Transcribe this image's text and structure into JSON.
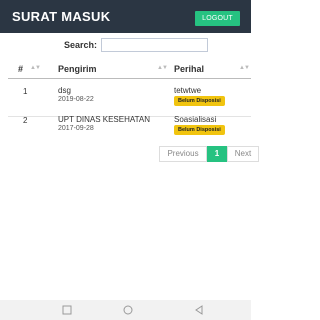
{
  "header": {
    "title": "SURAT MASUK",
    "logout_label": "LOGOUT"
  },
  "search": {
    "label": "Search:",
    "value": "",
    "placeholder": ""
  },
  "table": {
    "columns": [
      "#",
      "Pengirim",
      "Perihal"
    ],
    "rows": [
      {
        "no": "1",
        "sender": "dsg",
        "date": "2019-08-22",
        "subject": "tetwtwe",
        "status": "Belum Disposisi"
      },
      {
        "no": "2",
        "sender": "UPT DINAS KESEHATAN",
        "date": "2017-09-28",
        "subject": "Soasialisasi",
        "status": "Belum Disposisi"
      }
    ]
  },
  "pagination": {
    "prev": "Previous",
    "current": "1",
    "next": "Next"
  },
  "colors": {
    "header_bg": "#2b3643",
    "accent": "#26c281",
    "badge": "#f1c40f"
  },
  "android_nav": {
    "icons": [
      "recent-apps-icon",
      "home-icon",
      "back-icon"
    ]
  }
}
